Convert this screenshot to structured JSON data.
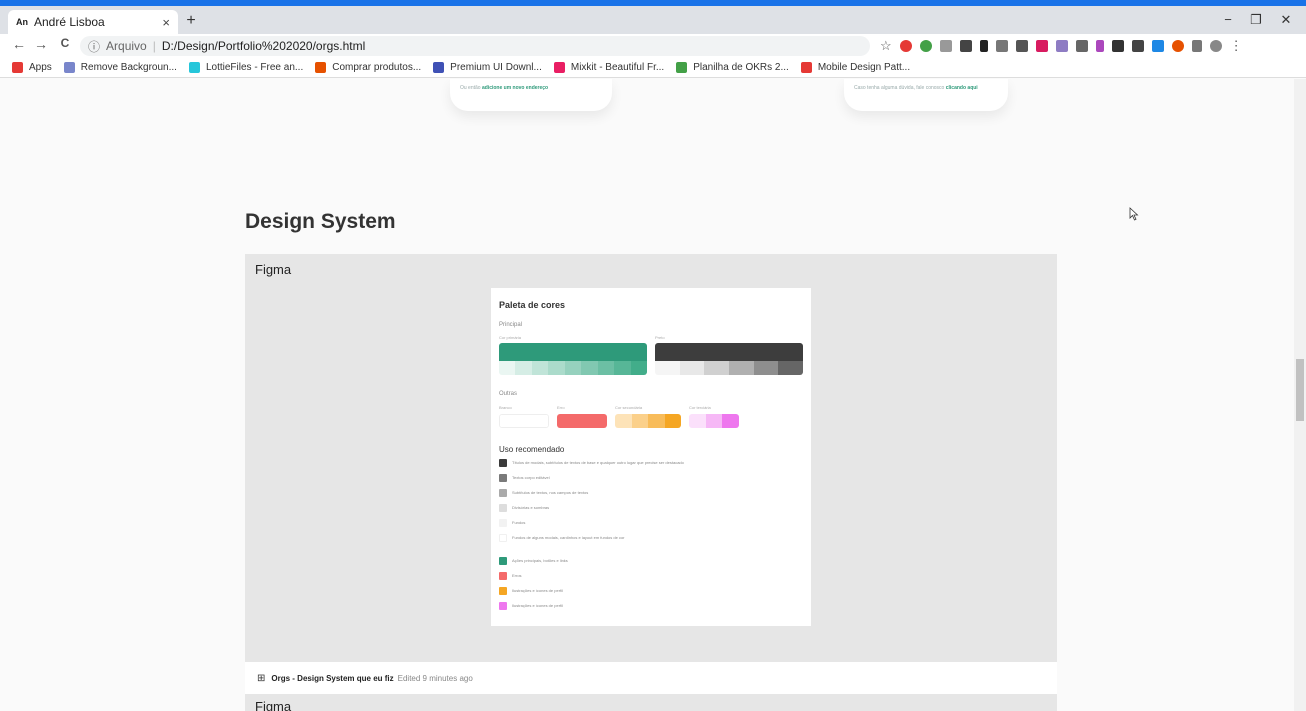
{
  "browser": {
    "tab_favicon": "An",
    "tab_title": "André Lisboa",
    "tab_close": "×",
    "new_tab": "+",
    "nav_back": "←",
    "nav_forward": "→",
    "nav_reload": "C",
    "address_info": "ⓘ",
    "address_protocol": "Arquivo",
    "address_url": "D:/Design/Portfolio%202020/orgs.html",
    "star": "☆",
    "menu": "⋮",
    "win_min": "−",
    "win_restore": "❐",
    "win_close": "✕"
  },
  "bookmarks": [
    {
      "label": "Apps",
      "color": "#e53935"
    },
    {
      "label": "Remove Backgroun...",
      "color": "#7986cb"
    },
    {
      "label": "LottieFiles - Free an...",
      "color": "#26c6da"
    },
    {
      "label": "Comprar produtos...",
      "color": "#e65100"
    },
    {
      "label": "Premium UI Downl...",
      "color": "#3f51b5"
    },
    {
      "label": "Mixkit - Beautiful Fr...",
      "color": "#e91e63"
    },
    {
      "label": "Planilha de OKRs 2...",
      "color": "#43a047"
    },
    {
      "label": "Mobile Design Patt...",
      "color": "#e53935"
    }
  ],
  "cards": {
    "left_text": "Ou então ",
    "left_link": "adicione um novo endereço",
    "right_text": "Caso tenha alguma dúvida, fale conosco ",
    "right_link": "clicando aqui"
  },
  "section": {
    "title": "Design System"
  },
  "embed": {
    "label": "Figma",
    "frame_title": "Paleta de cores",
    "principal_label": "Principal",
    "color1_label": "Cor primária",
    "color2_label": "Preto",
    "outras_label": "Outras",
    "outras": [
      {
        "label": "Branco"
      },
      {
        "label": "Erro"
      },
      {
        "label": "Cor secundária"
      },
      {
        "label": "Cor terciária"
      }
    ],
    "uso_title": "Uso recomendado",
    "uso": [
      {
        "text": "Títulos de modais, subtítulos de textos de base e qualquer outro lugar que precise ser destacado",
        "color": "#3a3a3a"
      },
      {
        "text": "Textos corpo editável",
        "color": "#7a7a7a"
      },
      {
        "text": "Subtítulos de textos, nos campos de textos",
        "color": "#aaaaaa"
      },
      {
        "text": "Divisórias e sombras",
        "color": "#dddddd"
      },
      {
        "text": "Fundos",
        "color": "#f2f2f2"
      },
      {
        "text": "Fundos de alguns modais, cardinhos e layout em fundos de cor",
        "color": "#ffffff"
      },
      {
        "text": "Ações principais, botões e links",
        "color": "#2e9a7a"
      },
      {
        "text": "Erros",
        "color": "#f46a6a"
      },
      {
        "text": "Ilustrações e ícones de perfil",
        "color": "#f5a623"
      },
      {
        "text": "Ilustrações e ícones de perfil",
        "color": "#ee77ee"
      }
    ]
  },
  "footer": {
    "icon": "⊞",
    "file_name": "Orgs - Design System que eu fiz",
    "edited": "Edited 9 minutes ago"
  },
  "embed2": {
    "label": "Figma"
  },
  "colors": {
    "primary": "#2e9a7a",
    "black": "#3d3d3d",
    "error": "#f46a6a",
    "secondary": "#f5a623",
    "tertiary": "#ee77ee",
    "accent": "#1a73e8"
  }
}
